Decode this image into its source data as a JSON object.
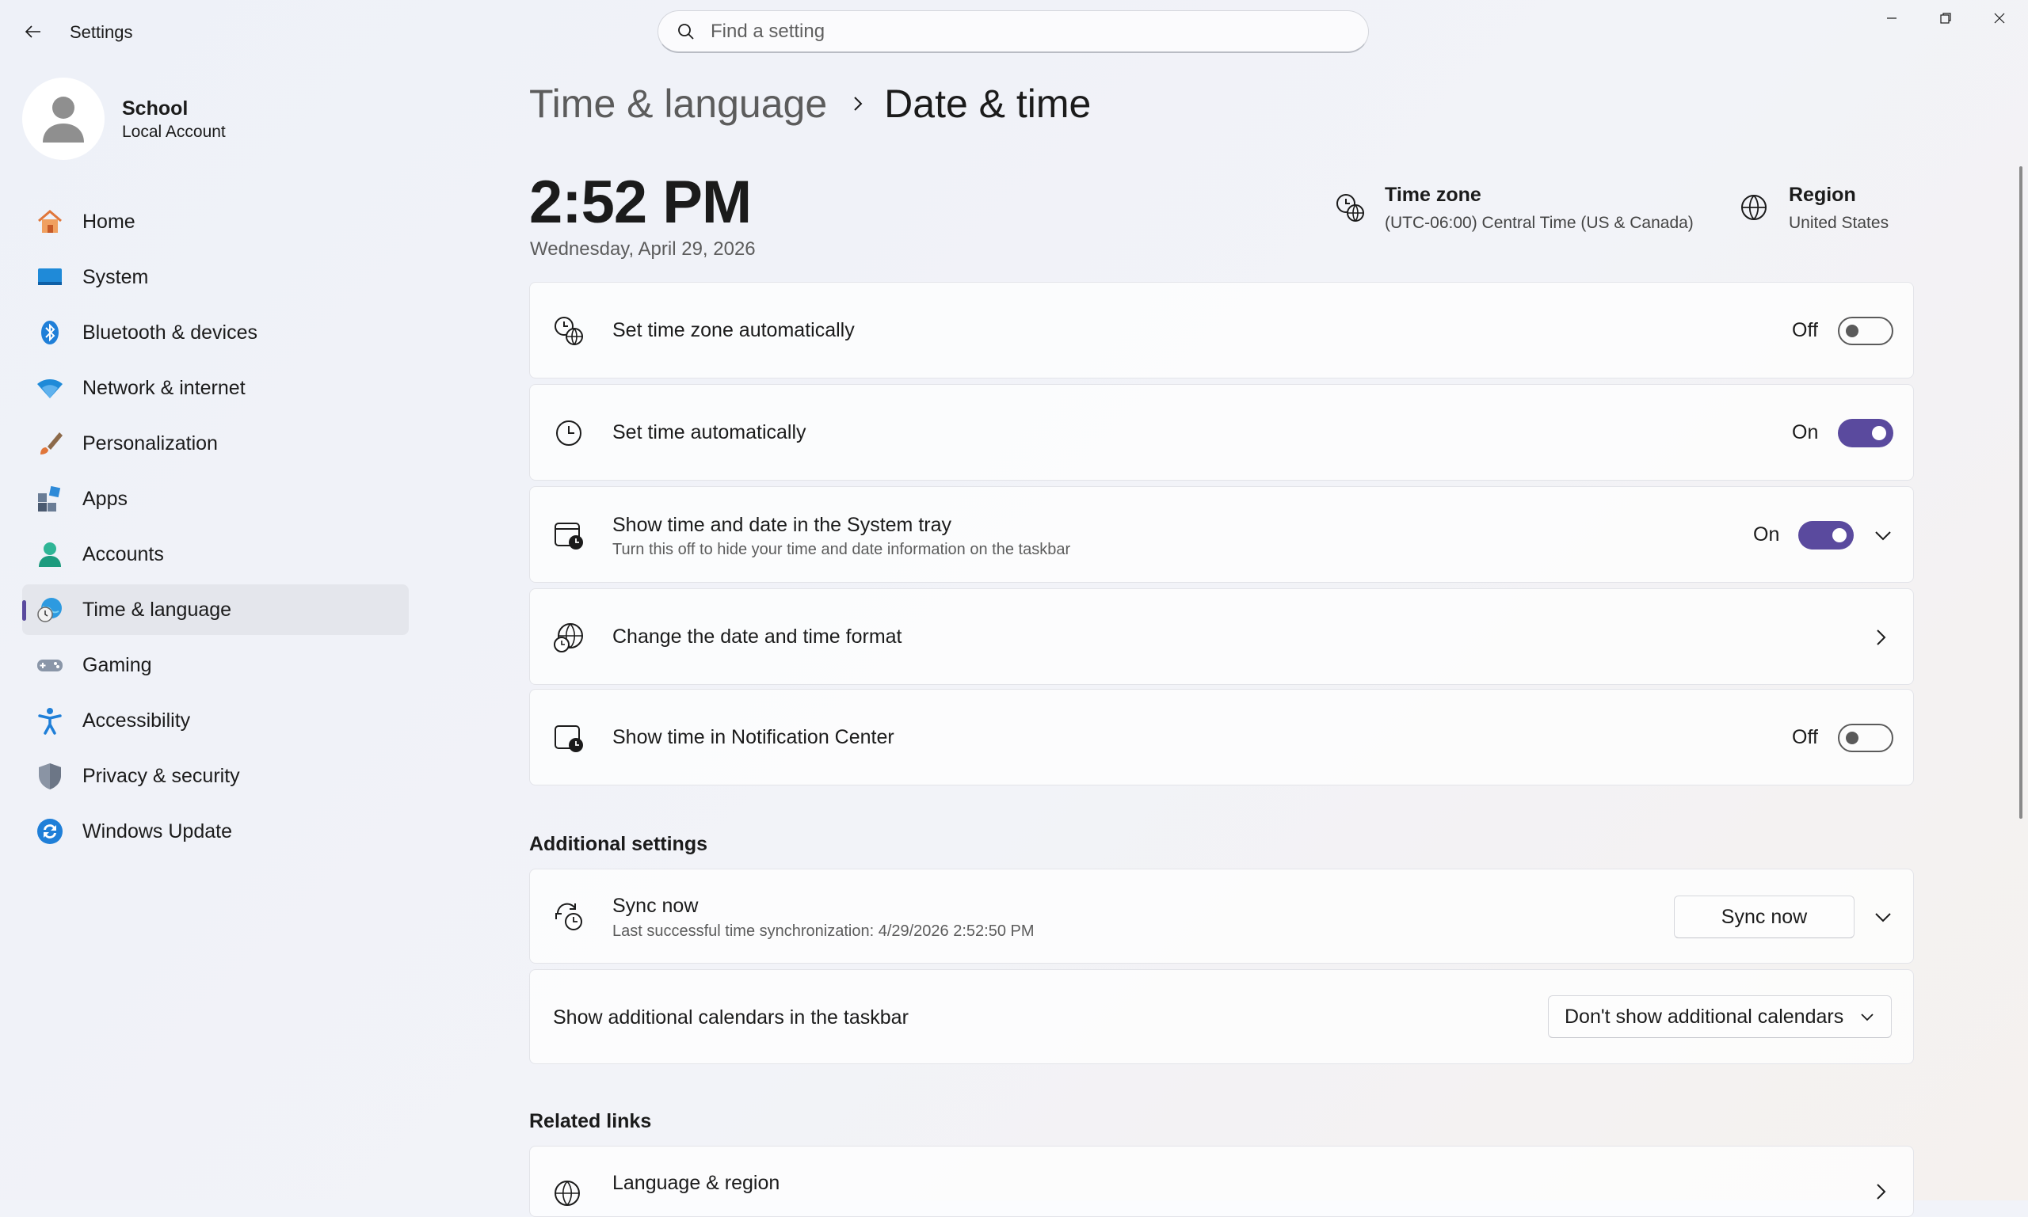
{
  "app": {
    "title": "Settings"
  },
  "search": {
    "placeholder": "Find a setting"
  },
  "profile": {
    "name": "School",
    "account_type": "Local Account"
  },
  "sidebar": {
    "items": [
      {
        "label": "Home",
        "icon": "home-icon"
      },
      {
        "label": "System",
        "icon": "system-icon"
      },
      {
        "label": "Bluetooth & devices",
        "icon": "bluetooth-icon"
      },
      {
        "label": "Network & internet",
        "icon": "wifi-icon"
      },
      {
        "label": "Personalization",
        "icon": "brush-icon"
      },
      {
        "label": "Apps",
        "icon": "apps-icon"
      },
      {
        "label": "Accounts",
        "icon": "accounts-icon"
      },
      {
        "label": "Time & language",
        "icon": "time-language-icon",
        "active": true
      },
      {
        "label": "Gaming",
        "icon": "gamepad-icon"
      },
      {
        "label": "Accessibility",
        "icon": "accessibility-icon"
      },
      {
        "label": "Privacy & security",
        "icon": "shield-icon"
      },
      {
        "label": "Windows Update",
        "icon": "update-icon"
      }
    ]
  },
  "breadcrumb": {
    "parent": "Time & language",
    "current": "Date & time"
  },
  "clock": {
    "time": "2:52 PM",
    "date": "Wednesday, April 29, 2026"
  },
  "timezone_info": {
    "title": "Time zone",
    "value": "(UTC-06:00) Central Time (US & Canada)"
  },
  "region_info": {
    "title": "Region",
    "value": "United States"
  },
  "settings": {
    "tz_auto": {
      "label": "Set time zone automatically",
      "state": "Off"
    },
    "time_auto": {
      "label": "Set time automatically",
      "state": "On"
    },
    "systray": {
      "label": "Show time and date in the System tray",
      "desc": "Turn this off to hide your time and date information on the taskbar",
      "state": "On"
    },
    "format": {
      "label": "Change the date and time format"
    },
    "notif": {
      "label": "Show time in Notification Center",
      "state": "Off"
    }
  },
  "additional": {
    "heading": "Additional settings",
    "sync": {
      "label": "Sync now",
      "desc": "Last successful time synchronization: 4/29/2026 2:52:50 PM",
      "button": "Sync now"
    },
    "calendars": {
      "label": "Show additional calendars in the taskbar",
      "selected": "Don't show additional calendars"
    }
  },
  "related": {
    "heading": "Related links",
    "language_region": "Language & region"
  },
  "colors": {
    "accent": "#5a4a9e",
    "background": "#f1f3f9",
    "card": "#ffffff"
  }
}
